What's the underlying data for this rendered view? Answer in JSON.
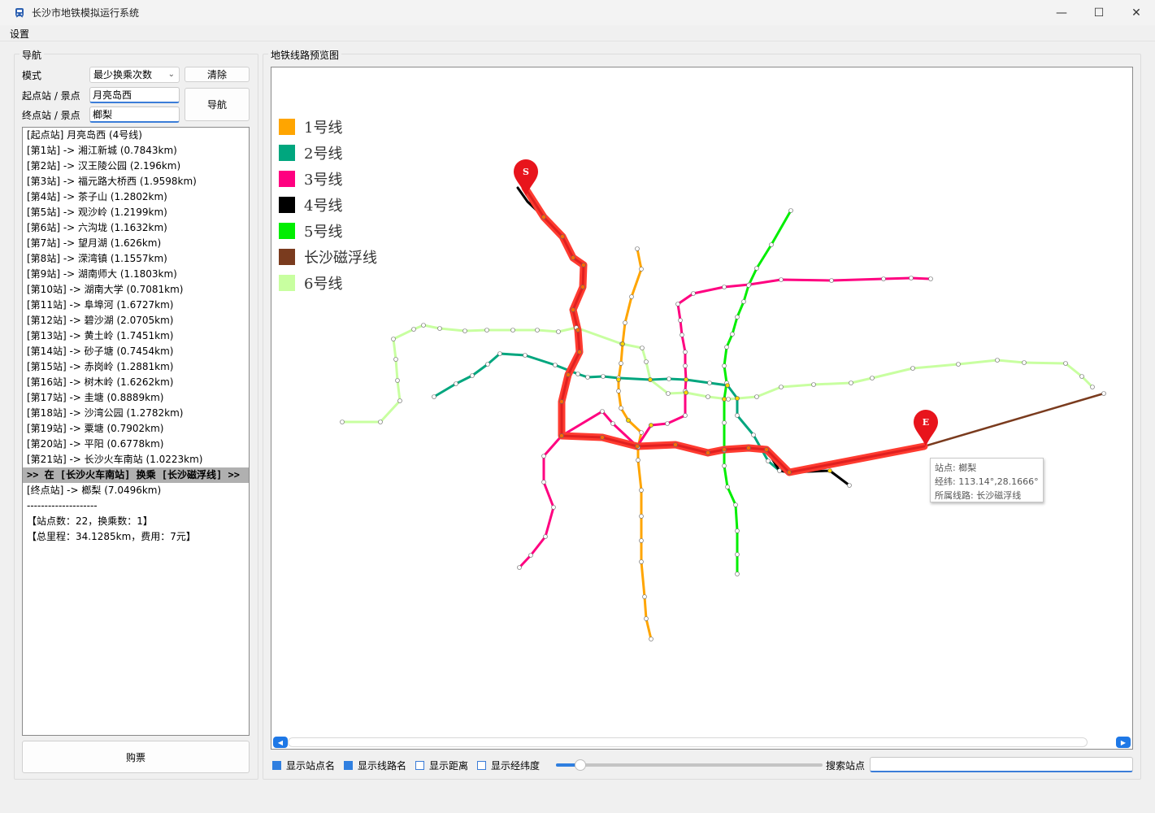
{
  "window": {
    "title": "长沙市地铁模拟运行系统",
    "minimize": "—",
    "maximize": "☐",
    "close": "✕"
  },
  "menu": {
    "settings": "设置"
  },
  "nav": {
    "group_title": "导航",
    "mode_label": "模式",
    "mode_value": "最少换乘次数",
    "clear_button": "清除",
    "start_label": "起点站 / 景点",
    "start_value": "月亮岛西",
    "end_label": "终点站 / 景点",
    "end_value": "榔梨",
    "navigate_button": "导航",
    "buy_button": "购票"
  },
  "route": [
    "[起点站] 月亮岛西 (4号线)",
    "[第1站] -> 湘江新城  (0.7843km)",
    "[第2站] -> 汉王陵公园  (2.196km)",
    "[第3站] -> 福元路大桥西  (1.9598km)",
    "[第4站] -> 茶子山  (1.2802km)",
    "[第5站] -> 观沙岭  (1.2199km)",
    "[第6站] -> 六沟垅  (1.1632km)",
    "[第7站] -> 望月湖  (1.626km)",
    "[第8站] -> 溁湾镇  (1.1557km)",
    "[第9站] -> 湖南师大  (1.1803km)",
    "[第10站] -> 湖南大学  (0.7081km)",
    "[第11站] -> 阜埠河  (1.6727km)",
    "[第12站] -> 碧沙湖  (2.0705km)",
    "[第13站] -> 黄土岭  (1.7451km)",
    "[第14站] -> 砂子塘  (0.7454km)",
    "[第15站] -> 赤岗岭  (1.2881km)",
    "[第16站] -> 树木岭  (1.6262km)",
    "[第17站] -> 圭塘  (0.8889km)",
    "[第18站] -> 沙湾公园  (1.2782km)",
    "[第19站] -> 粟塘  (0.7902km)",
    "[第20站] -> 平阳  (0.6778km)",
    "[第21站] -> 长沙火车南站  (1.0223km)",
    ">> 在 [长沙火车南站] 换乘 [长沙磁浮线] >>",
    "[终点站] -> 榔梨  (7.0496km)",
    "--------------------",
    "【站点数：22，换乘数：1】",
    "【总里程：34.1285km，费用：7元】"
  ],
  "map": {
    "group_title": "地铁线路预览图",
    "legend": [
      {
        "name": "1号线",
        "color": "#ffa500"
      },
      {
        "name": "2号线",
        "color": "#00a67e"
      },
      {
        "name": "3号线",
        "color": "#ff0080"
      },
      {
        "name": "4号线",
        "color": "#000000"
      },
      {
        "name": "5号线",
        "color": "#00ee00"
      },
      {
        "name": "长沙磁浮线",
        "color": "#7a3b1e"
      },
      {
        "name": "6号线",
        "color": "#c8ffa0"
      }
    ],
    "start_marker": "S",
    "end_marker": "E",
    "tooltip": {
      "station": "站点: 榔梨",
      "coords": "经纬: 113.14°,28.1666°",
      "line": "所属线路: 长沙磁浮线"
    }
  },
  "controls": {
    "show_station_names": "显示站点名",
    "show_line_names": "显示线路名",
    "show_distance": "显示距离",
    "show_coords": "显示经纬度",
    "search_label": "搜索站点",
    "search_value": "",
    "station_names_on": true,
    "line_names_on": true,
    "distance_on": false,
    "coords_on": false,
    "zoom_level": 0.07
  }
}
